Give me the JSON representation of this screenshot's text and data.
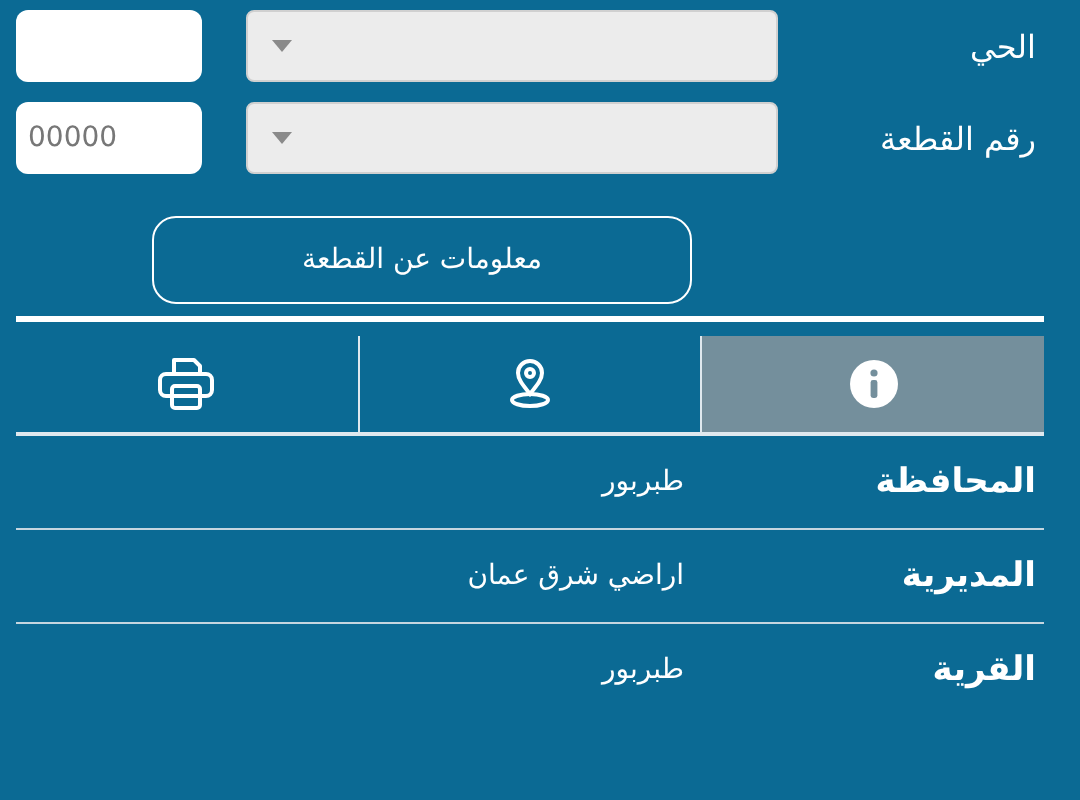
{
  "form_rows": [
    {
      "label": "الحي"
    },
    {
      "label": "رقم القطعة",
      "placeholder": "00000"
    }
  ],
  "info_button": {
    "label": "معلومات عن القطعة"
  },
  "tabs": [
    {
      "kind": "info",
      "selected": true
    },
    {
      "kind": "location",
      "selected": false
    },
    {
      "kind": "print",
      "selected": false
    }
  ],
  "details": [
    {
      "label": "المحافظة",
      "value": "طبربور"
    },
    {
      "label": "المديرية",
      "value": "اراضي شرق عمان"
    },
    {
      "label": "القرية",
      "value": "طبربور"
    }
  ]
}
